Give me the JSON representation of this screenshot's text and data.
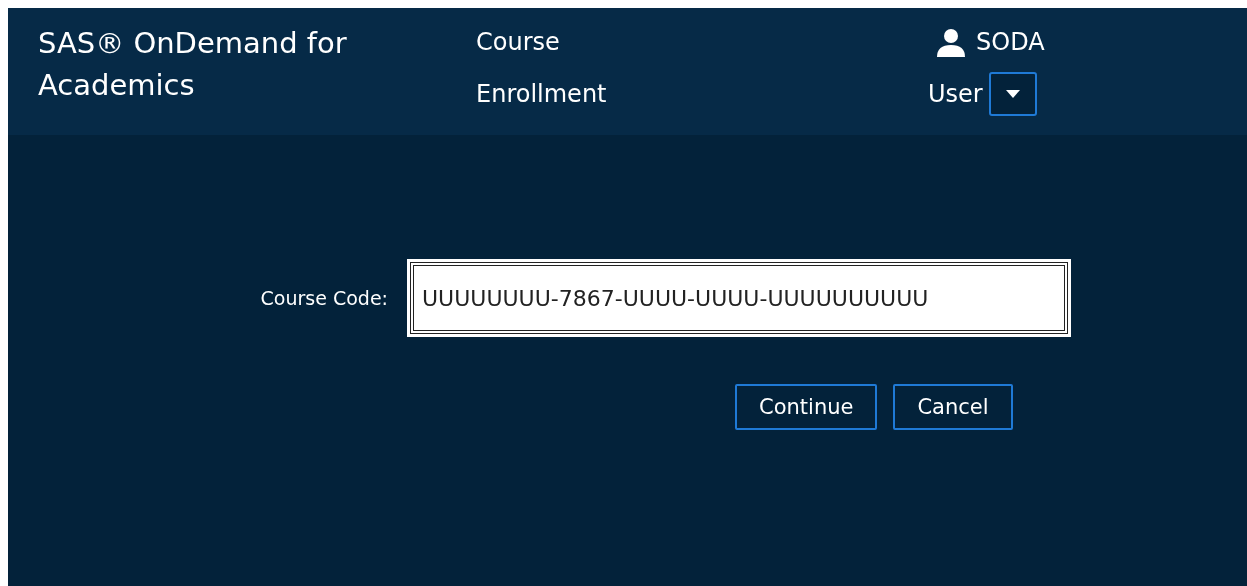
{
  "header": {
    "title_line1": "SAS® OnDemand for",
    "title_line2": "Academics",
    "page_line1": "Course",
    "page_line2": "Enrollment",
    "user_line1": "SODA",
    "user_line2": "User"
  },
  "form": {
    "label": "Course Code:",
    "value": "UUUUUUUU-7867-UUUU-UUUU-UUUUUUUUUU",
    "focused": true
  },
  "buttons": [
    "Continue",
    "Cancel"
  ]
}
